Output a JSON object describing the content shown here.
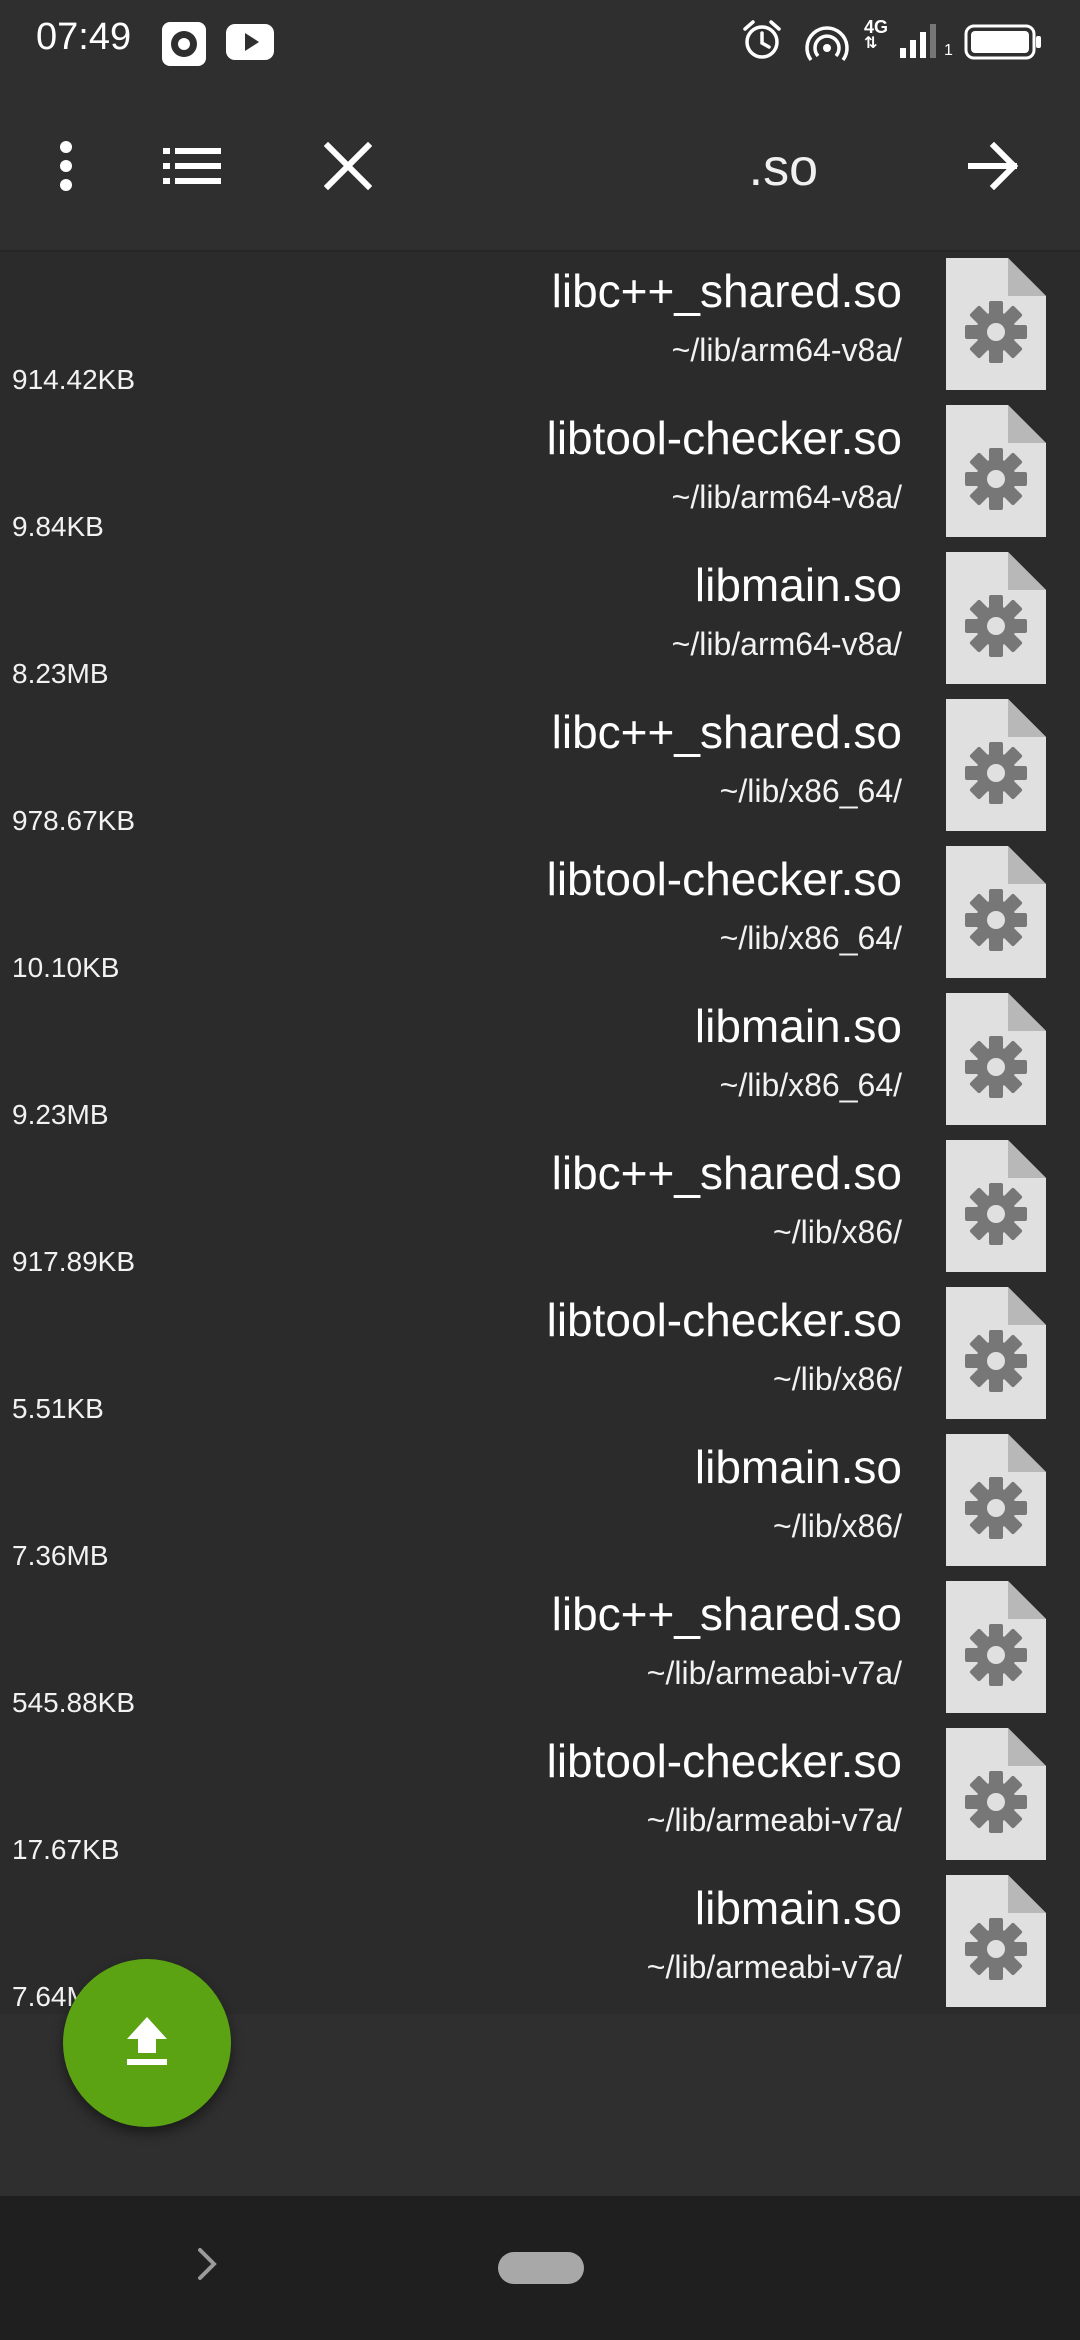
{
  "status_bar": {
    "time": "07:49",
    "network_type": "4G",
    "sim_slot": "1",
    "icons": [
      "record-icon",
      "youtube-icon",
      "alarm-icon",
      "hotspot-icon",
      "signal-icon",
      "battery-icon"
    ]
  },
  "toolbar": {
    "title": ".so",
    "icons": [
      "more-vert-icon",
      "list-view-icon",
      "close-icon",
      "arrow-forward-icon"
    ]
  },
  "files": [
    {
      "name": "libc++_shared.so",
      "path": "~/lib/arm64-v8a/",
      "size": "914.42KB"
    },
    {
      "name": "libtool-checker.so",
      "path": "~/lib/arm64-v8a/",
      "size": "9.84KB"
    },
    {
      "name": "libmain.so",
      "path": "~/lib/arm64-v8a/",
      "size": "8.23MB"
    },
    {
      "name": "libc++_shared.so",
      "path": "~/lib/x86_64/",
      "size": "978.67KB"
    },
    {
      "name": "libtool-checker.so",
      "path": "~/lib/x86_64/",
      "size": "10.10KB"
    },
    {
      "name": "libmain.so",
      "path": "~/lib/x86_64/",
      "size": "9.23MB"
    },
    {
      "name": "libc++_shared.so",
      "path": "~/lib/x86/",
      "size": "917.89KB"
    },
    {
      "name": "libtool-checker.so",
      "path": "~/lib/x86/",
      "size": "5.51KB"
    },
    {
      "name": "libmain.so",
      "path": "~/lib/x86/",
      "size": "7.36MB"
    },
    {
      "name": "libc++_shared.so",
      "path": "~/lib/armeabi-v7a/",
      "size": "545.88KB"
    },
    {
      "name": "libtool-checker.so",
      "path": "~/lib/armeabi-v7a/",
      "size": "17.67KB"
    },
    {
      "name": "libmain.so",
      "path": "~/lib/armeabi-v7a/",
      "size": "7.64MB"
    }
  ],
  "colors": {
    "background": "#2b2b2b",
    "toolbar": "#2f2f2f",
    "fab": "#5ba313",
    "file_icon_bg": "#e0e0e0",
    "file_icon_gear": "#777777"
  }
}
